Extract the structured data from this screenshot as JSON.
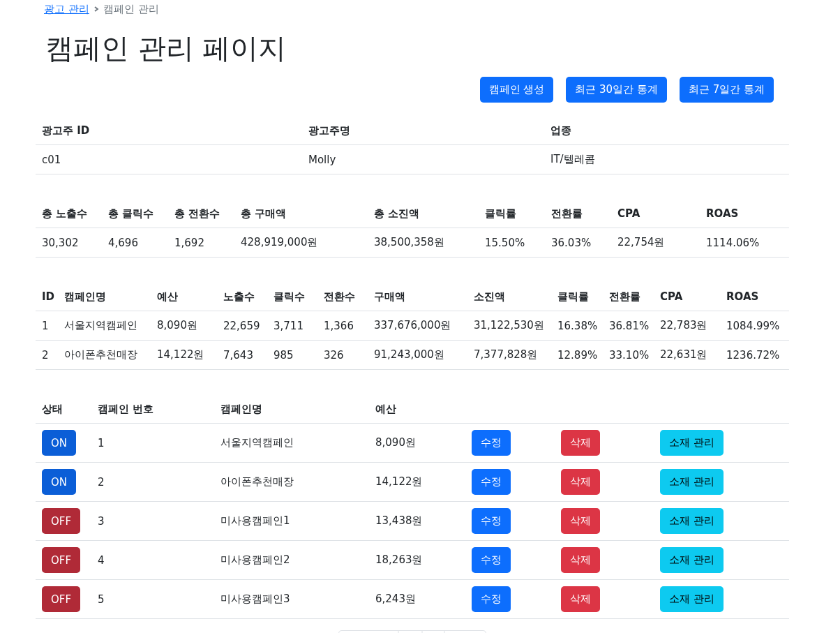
{
  "breadcrumb": [
    {
      "label": "광고 관리",
      "link": true
    },
    {
      "label": "캠페인 관리",
      "link": false
    }
  ],
  "title": "캠페인 관리 페이지",
  "actions": [
    "캠페인 생성",
    "최근 30일간 통계",
    "최근 7일간 통계"
  ],
  "advertiser": {
    "columns": [
      "광고주 ID",
      "광고주명",
      "업종"
    ],
    "rows": [
      [
        "c01",
        "Molly",
        "IT/텔레콤"
      ]
    ]
  },
  "totals": {
    "columns": [
      "총 노출수",
      "총 클릭수",
      "총 전환수",
      "총 구매액",
      "총 소진액",
      "클릭률",
      "전환률",
      "CPA",
      "ROAS"
    ],
    "rows": [
      [
        "30,302",
        "4,696",
        "1,692",
        "428,919,000원",
        "38,500,358원",
        "15.50%",
        "36.03%",
        "22,754원",
        "1114.06%"
      ]
    ]
  },
  "campaign_stats": {
    "columns": [
      "ID",
      "캠페인명",
      "예산",
      "노출수",
      "클릭수",
      "전환수",
      "구매액",
      "소진액",
      "클릭률",
      "전환률",
      "CPA",
      "ROAS"
    ],
    "rows": [
      [
        "1",
        "서울지역캠페인",
        "8,090원",
        "22,659",
        "3,711",
        "1,366",
        "337,676,000원",
        "31,122,530원",
        "16.38%",
        "36.81%",
        "22,783원",
        "1084.99%"
      ],
      [
        "2",
        "아이폰추천매장",
        "14,122원",
        "7,643",
        "985",
        "326",
        "91,243,000원",
        "7,377,828원",
        "12.89%",
        "33.10%",
        "22,631원",
        "1236.72%"
      ]
    ]
  },
  "campaigns": {
    "columns": [
      "상태",
      "캠페인 번호",
      "캠페인명",
      "예산"
    ],
    "rows": [
      {
        "status": {
          "label": "ON",
          "on": true
        },
        "number": "1",
        "name": "서울지역캠페인",
        "budget": "8,090원",
        "edit": "수정",
        "delete": "삭제",
        "assets": "소재 관리"
      },
      {
        "status": {
          "label": "ON",
          "on": true
        },
        "number": "2",
        "name": "아이폰추천매장",
        "budget": "14,122원",
        "edit": "수정",
        "delete": "삭제",
        "assets": "소재 관리"
      },
      {
        "status": {
          "label": "OFF",
          "on": false
        },
        "number": "3",
        "name": "미사용캠페인1",
        "budget": "13,438원",
        "edit": "수정",
        "delete": "삭제",
        "assets": "소재 관리"
      },
      {
        "status": {
          "label": "OFF",
          "on": false
        },
        "number": "4",
        "name": "미사용캠페인2",
        "budget": "18,263원",
        "edit": "수정",
        "delete": "삭제",
        "assets": "소재 관리"
      },
      {
        "status": {
          "label": "OFF",
          "on": false
        },
        "number": "5",
        "name": "미사용캠페인3",
        "budget": "6,243원",
        "edit": "수정",
        "delete": "삭제",
        "assets": "소재 관리"
      }
    ]
  }
}
